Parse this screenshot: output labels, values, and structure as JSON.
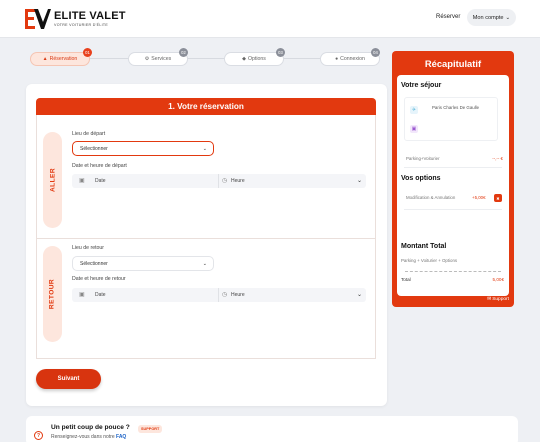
{
  "header": {
    "brand": "ELITE VALET",
    "tagline": "VOTRE VOITURIER D'ÉLITE",
    "nav_reserver": "Réserver",
    "nav_account": "Mon compte",
    "account_chevron": "chevron-down-icon"
  },
  "stepper": {
    "steps": [
      {
        "label": "Réservation",
        "number": "01",
        "icon": "car-icon",
        "active": true
      },
      {
        "label": "Services",
        "number": "02",
        "icon": "gear-icon",
        "active": false
      },
      {
        "label": "Options",
        "number": "03",
        "icon": "shield-icon",
        "active": false
      },
      {
        "label": "Connexion",
        "number": "04",
        "icon": "user-icon",
        "active": false
      }
    ]
  },
  "form": {
    "title": "1. Votre réservation",
    "aller": {
      "side_label": "ALLER",
      "place_label": "Lieu de départ",
      "place_value": "Sélectionner",
      "datetime_label": "Date et heure de départ",
      "date_placeholder": "Date",
      "time_placeholder": "Heure"
    },
    "retour": {
      "side_label": "RETOUR",
      "place_label": "Lieu de retour",
      "place_value": "Sélectionner",
      "datetime_label": "Date et heure de retour",
      "date_placeholder": "Date",
      "time_placeholder": "Heure"
    },
    "submit_label": "Suivant"
  },
  "summary": {
    "title": "Récapitulatif",
    "sejour_heading": "Votre séjour",
    "airport": "Paris Charles De Gaulle",
    "parking_label": "Parking+Voiturier",
    "parking_value": "--,-- €",
    "options_heading": "Vos options",
    "option_label": "Modification & Annulation",
    "option_value": "+5,00€",
    "total_heading": "Montant Total",
    "total_sub": "Parking + Voiturier + Options",
    "total_label": "Total",
    "total_value": "5,00€",
    "support": "Support"
  },
  "help": {
    "title": "Un petit coup de pouce ?",
    "badge": "SUPPORT",
    "sub_prefix": "Renseignez-vous dans notre ",
    "sub_link": "FAQ"
  },
  "colors": {
    "accent": "#e2390f",
    "accent_soft": "#fde6dd",
    "background": "#eef0f4"
  }
}
